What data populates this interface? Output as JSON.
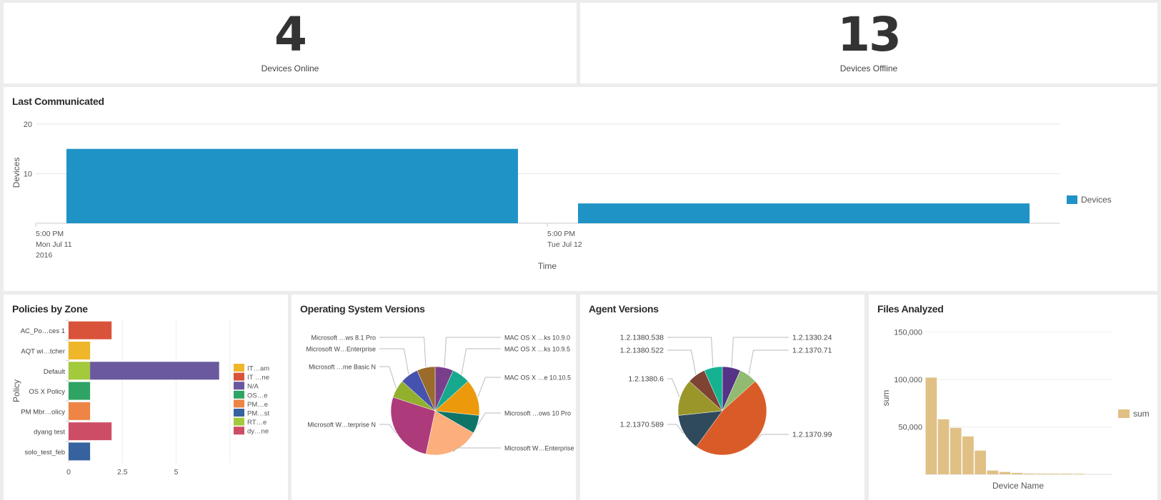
{
  "metrics": [
    {
      "value": "4",
      "label": "Devices Online"
    },
    {
      "value": "13",
      "label": "Devices Offline"
    }
  ],
  "panels": {
    "last_communicated": "Last Communicated",
    "policies": "Policies by Zone",
    "os": "Operating System Versions",
    "agent": "Agent Versions",
    "files": "Files Analyzed"
  },
  "chart_data": [
    {
      "id": "last_communicated",
      "type": "bar",
      "title": "Last Communicated",
      "xlabel": "Time",
      "ylabel": "Devices",
      "ylim": [
        0,
        20
      ],
      "yticks": [
        "10",
        "20"
      ],
      "ytick_values": [
        10,
        20
      ],
      "categories": [
        [
          "5:00 PM",
          "Mon Jul 11",
          "2016"
        ],
        [
          "5:00 PM",
          "Tue Jul 12"
        ]
      ],
      "series": [
        {
          "name": "Devices",
          "color": "#1f93c6",
          "values": [
            15,
            4
          ]
        }
      ],
      "legend": "right",
      "grid": true
    },
    {
      "id": "policies",
      "type": "bar",
      "orientation": "horizontal",
      "stacked": true,
      "title": "Policies by Zone",
      "ylabel": "Policy",
      "xlim": [
        0,
        9
      ],
      "xticks": [
        "0",
        "2.5",
        "5"
      ],
      "xtick_values": [
        0,
        2.5,
        5
      ],
      "categories": [
        "AC_Po…ces 1",
        "AQT wi…tcher",
        "Default",
        "OS X Policy",
        "PM Mbr…olicy",
        "dyang test",
        "solo_test_feb"
      ],
      "series": [
        {
          "name": "IT…am",
          "color": "#f0b62a",
          "values": [
            0,
            1,
            0,
            0,
            0,
            0,
            0
          ]
        },
        {
          "name": "IT …ne",
          "color": "#d9533a",
          "values": [
            2,
            0,
            0,
            0,
            0,
            0,
            0
          ]
        },
        {
          "name": "N/A",
          "color": "#6a599e",
          "values": [
            0,
            0,
            6,
            0,
            0,
            0,
            0
          ]
        },
        {
          "name": "OS…e",
          "color": "#2fa363",
          "values": [
            0,
            0,
            0,
            1,
            0,
            0,
            0
          ]
        },
        {
          "name": "PM…e",
          "color": "#ee8545",
          "values": [
            0,
            0,
            0,
            0,
            1,
            0,
            0
          ]
        },
        {
          "name": "PM…st",
          "color": "#3762a0",
          "values": [
            0,
            0,
            0,
            0,
            0,
            0,
            1
          ]
        },
        {
          "name": "RT…e",
          "color": "#a3c93c",
          "values": [
            0,
            0,
            1,
            0,
            0,
            0,
            0
          ]
        },
        {
          "name": "dy…ne",
          "color": "#ce4d66",
          "values": [
            0,
            0,
            0,
            0,
            0,
            2,
            0
          ]
        }
      ],
      "stack_order": [
        "RT…e",
        "IT…am",
        "IT …ne",
        "N/A",
        "OS…e",
        "PM…e",
        "PM…st",
        "dy…ne"
      ],
      "legend": "right",
      "grid": true
    },
    {
      "id": "os",
      "type": "pie",
      "title": "Operating System Versions",
      "slices": [
        {
          "label": "MAC OS X …ks 10.9.0",
          "value": 1,
          "color": "#7a3f8c",
          "side": "right"
        },
        {
          "label": "MAC OS X …ks 10.9.5",
          "value": 1,
          "color": "#17a98e",
          "side": "right"
        },
        {
          "label": "MAC OS X …e 10.10.5",
          "value": 2,
          "color": "#ec9a0b",
          "side": "right"
        },
        {
          "label": "Microsoft …ows 10 Pro",
          "value": 1,
          "color": "#0f7468",
          "side": "right"
        },
        {
          "label": "Microsoft W…Enterprise",
          "value": 3,
          "color": "#fcaf7c",
          "side": "right"
        },
        {
          "label": "Microsoft W…terprise N",
          "value": 4,
          "color": "#ad3a7b",
          "side": "left"
        },
        {
          "label": "Microsoft …me Basic N",
          "value": 1,
          "color": "#91b02e",
          "side": "left"
        },
        {
          "label": "Microsoft W…Enterprise",
          "value": 1,
          "color": "#4552ae",
          "side": "left"
        },
        {
          "label": "Microsoft …ws 8.1 Pro",
          "value": 1,
          "color": "#9b6b2a",
          "side": "left"
        }
      ]
    },
    {
      "id": "agent",
      "type": "pie",
      "title": "Agent Versions",
      "slices": [
        {
          "label": "1.2.1330.24",
          "value": 1,
          "color": "#553387",
          "side": "right"
        },
        {
          "label": "1.2.1370.71",
          "value": 1,
          "color": "#92bb71",
          "side": "right"
        },
        {
          "label": "1.2.1370.99",
          "value": 7,
          "color": "#d95c28",
          "side": "right"
        },
        {
          "label": "1.2.1370.589",
          "value": 2,
          "color": "#2f4a5c",
          "side": "left"
        },
        {
          "label": "1.2.1380.6",
          "value": 2,
          "color": "#9a962a",
          "side": "left"
        },
        {
          "label": "1.2.1380.522",
          "value": 1,
          "color": "#7e4333",
          "side": "left"
        },
        {
          "label": "1.2.1380.538",
          "value": 1,
          "color": "#14b291",
          "side": "left"
        }
      ]
    },
    {
      "id": "files",
      "type": "bar",
      "title": "Files Analyzed",
      "xlabel": "Device Name",
      "ylabel": "sum",
      "ylim": [
        0,
        150000
      ],
      "yticks": [
        "50,000",
        "100,000",
        "150,000"
      ],
      "ytick_values": [
        50000,
        100000,
        150000
      ],
      "series": [
        {
          "name": "sum",
          "color": "#e0c085",
          "values": [
            102000,
            58000,
            49000,
            40000,
            25000,
            4000,
            2500,
            1500,
            800,
            700,
            700,
            700,
            600
          ]
        }
      ],
      "legend": "right",
      "grid": true
    }
  ]
}
